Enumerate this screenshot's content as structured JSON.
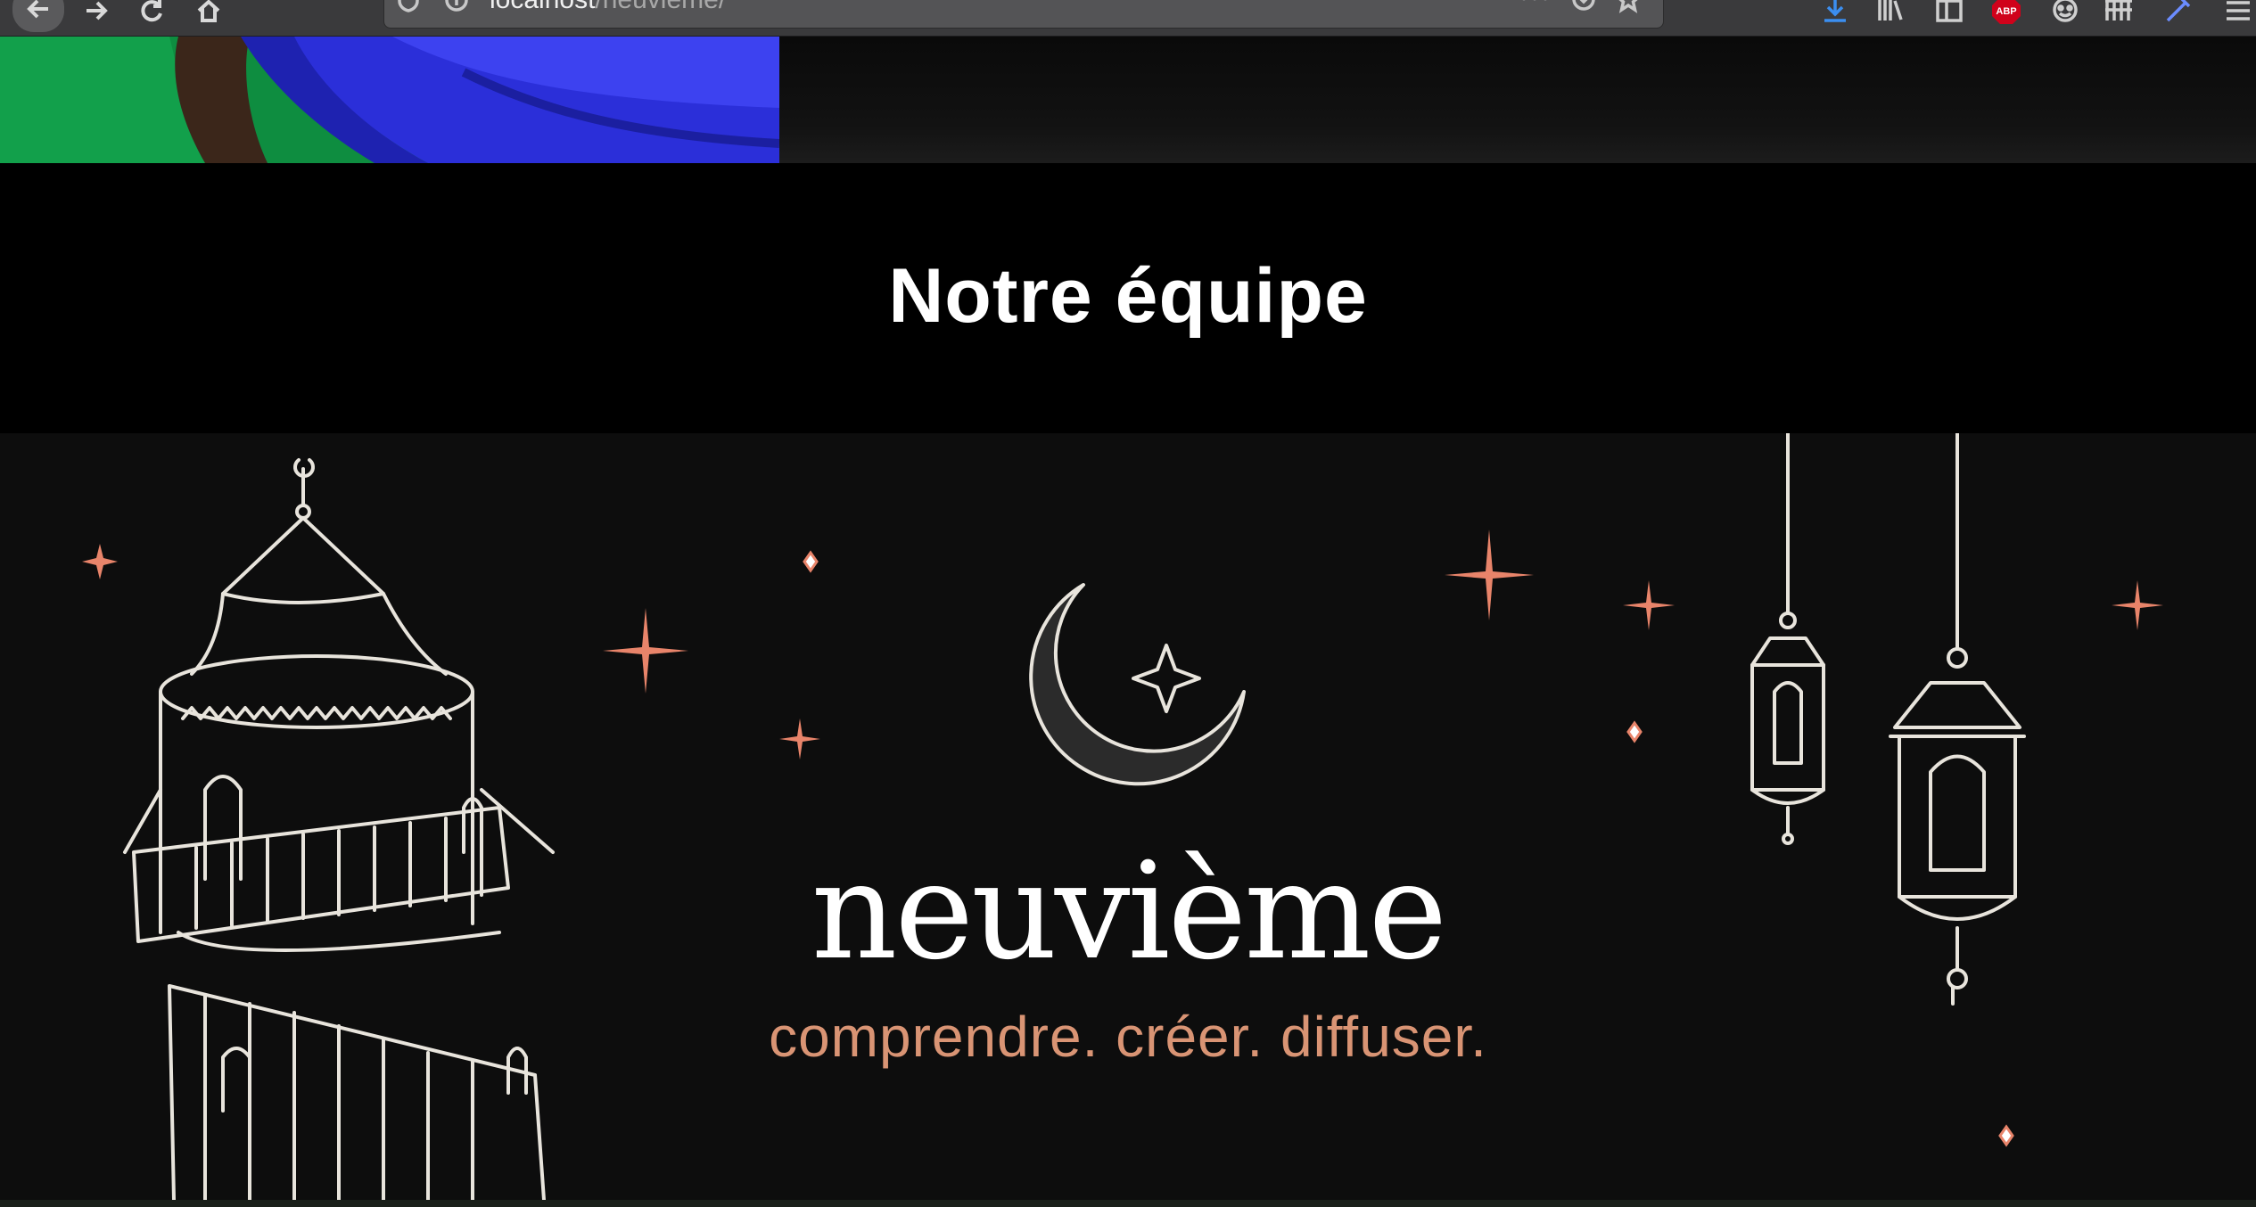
{
  "browser": {
    "url_host": "localhost",
    "url_path": "/neuvieme/",
    "toolbar_icons": [
      "back-icon",
      "forward-icon",
      "reload-icon",
      "home-icon",
      "downloads-icon",
      "library-icon",
      "sidebar-icon",
      "adblock-icon",
      "extension-icon",
      "extension-icon-2",
      "pen-icon",
      "menu-icon"
    ],
    "adblock_badge": "ABP"
  },
  "team_section": {
    "title": "Notre équipe"
  },
  "brand": {
    "name": "neuvième",
    "tagline": "comprendre. créer. diffuser."
  },
  "colors": {
    "band_background": "#000000",
    "page_background": "#0d0d0d",
    "tagline": "#d99474",
    "star_accent": "#e8846a",
    "line_art": "#e8e4dc"
  }
}
